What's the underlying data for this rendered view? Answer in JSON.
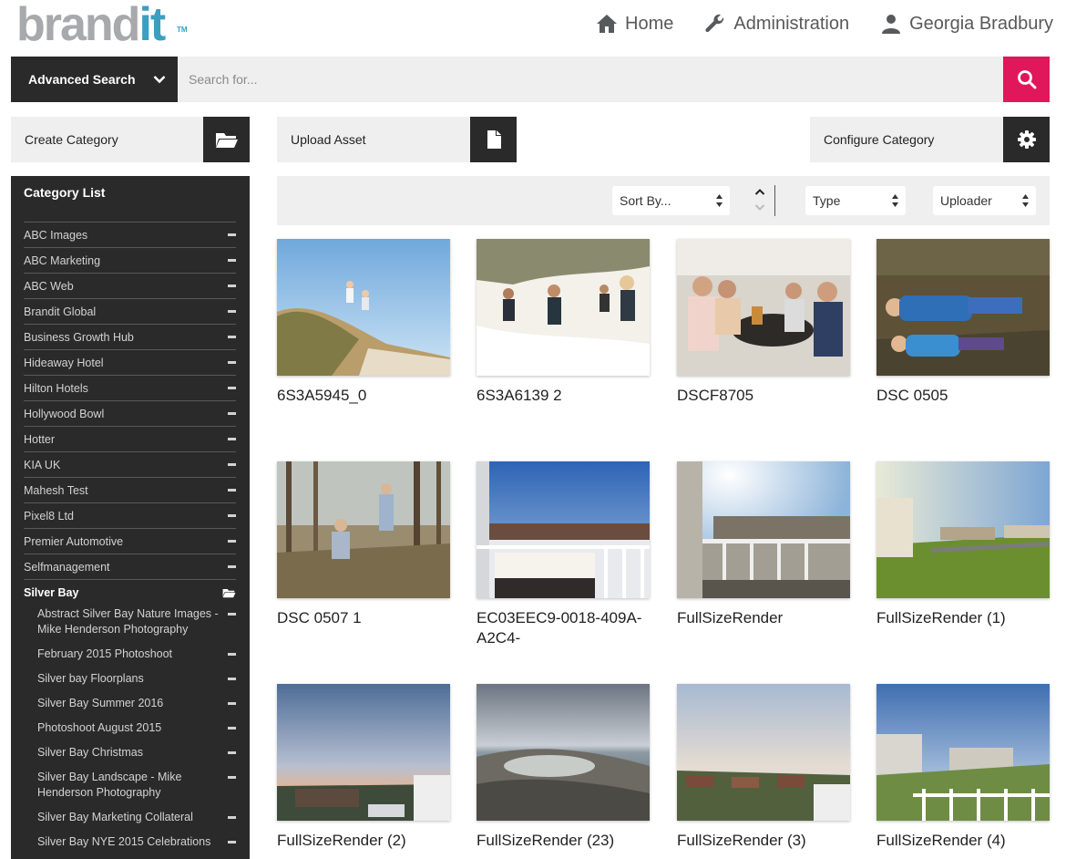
{
  "brand": {
    "part1": "brand",
    "part2": "it",
    "tm": "TM"
  },
  "nav": {
    "home": "Home",
    "administration": "Administration",
    "user": "Georgia Bradbury"
  },
  "search": {
    "advanced_label": "Advanced Search",
    "placeholder": "Search for...",
    "value": ""
  },
  "actions": {
    "create_category": "Create Category",
    "upload_asset": "Upload Asset",
    "configure_category": "Configure Category"
  },
  "sidebar": {
    "title": "Category List",
    "items": [
      "ABC Images",
      "ABC Marketing",
      "ABC Web",
      "Brandit Global",
      "Business Growth Hub",
      "Hideaway Hotel",
      "Hilton Hotels",
      "Hollywood Bowl",
      "Hotter",
      "KIA UK",
      "Mahesh Test",
      "Pixel8 Ltd",
      "Premier Automotive",
      "Selfmanagement"
    ],
    "active_item": "Silver Bay",
    "subitems": [
      "Abstract Silver Bay Nature Images - Mike Henderson Photography",
      "February 2015 Photoshoot",
      "Silver bay Floorplans",
      "Silver Bay Summer 2016",
      "Photoshoot August 2015",
      "Silver Bay Christmas",
      "Silver Bay Landscape - Mike Henderson Photography",
      "Silver Bay Marketing Collateral",
      "Silver Bay NYE 2015 Celebrations"
    ]
  },
  "filters": {
    "sort_by": "Sort By...",
    "type": "Type",
    "uploader": "Uploader"
  },
  "assets": [
    {
      "name": "6S3A5945_0"
    },
    {
      "name": "6S3A6139 2"
    },
    {
      "name": "DSCF8705"
    },
    {
      "name": "DSC 0505"
    },
    {
      "name": "DSC 0507 1"
    },
    {
      "name": "EC03EEC9-0018-409A-A2C4-"
    },
    {
      "name": "FullSizeRender"
    },
    {
      "name": "FullSizeRender (1)"
    },
    {
      "name": "FullSizeRender (2)"
    },
    {
      "name": "FullSizeRender (23)"
    },
    {
      "name": "FullSizeRender (3)"
    },
    {
      "name": "FullSizeRender (4)"
    }
  ],
  "colors": {
    "dark": "#2b2a2a",
    "accent": "#e0175b",
    "panel": "#efefef",
    "logo_grey": "#a7a9ac",
    "logo_blue": "#3b9fc1"
  },
  "icons": {
    "home": "home-icon",
    "administration": "wrench-icon",
    "user": "user-icon",
    "search": "search-icon",
    "create_category": "folder-open-icon",
    "upload_asset": "file-icon",
    "configure_category": "gear-icon"
  }
}
